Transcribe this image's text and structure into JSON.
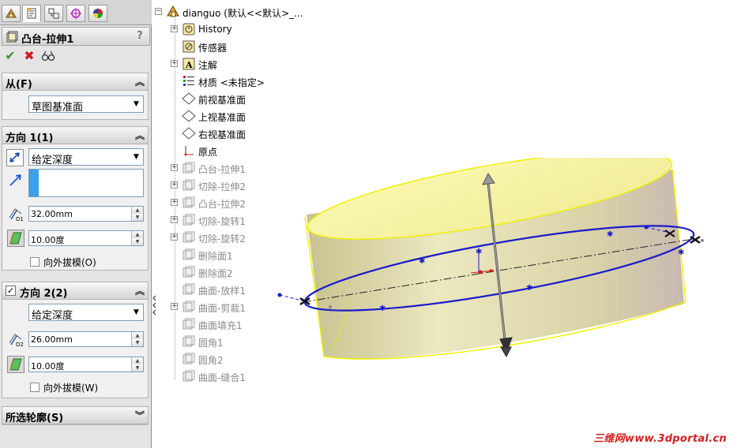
{
  "property_manager": {
    "tabs": [
      "feature-manager-icon",
      "property-manager-icon",
      "configuration-manager-icon",
      "dimxpert-icon",
      "display-manager-icon"
    ],
    "title": "凸台-拉伸1",
    "help_label": "?",
    "from": {
      "header": "从(F)",
      "value": "草图基准面"
    },
    "direction1": {
      "header": "方向 1(1)",
      "end_condition": "给定深度",
      "depth": "32.00mm",
      "depth_tag": "D1",
      "draft_angle": "10.00度",
      "draft_outward": "向外拔模(O)"
    },
    "direction2": {
      "header": "方向 2(2)",
      "enabled_mark": "✓",
      "end_condition": "给定深度",
      "depth": "26.00mm",
      "depth_tag": "D2",
      "draft_angle": "10.00度",
      "draft_outward": "向外拔模(W)"
    },
    "selected_contours": {
      "header": "所选轮廓(S)"
    }
  },
  "tree": {
    "root": "dianguo  (默认<<默认>_...",
    "items": [
      {
        "label": "History",
        "expand": "+",
        "dim": false
      },
      {
        "label": "传感器",
        "expand": "",
        "dim": false
      },
      {
        "label": "注解",
        "expand": "+",
        "dim": false
      },
      {
        "label": "材质 <未指定>",
        "expand": "",
        "dim": false
      },
      {
        "label": "前视基准面",
        "expand": "",
        "dim": false
      },
      {
        "label": "上视基准面",
        "expand": "",
        "dim": false
      },
      {
        "label": "右视基准面",
        "expand": "",
        "dim": false
      },
      {
        "label": "原点",
        "expand": "",
        "dim": false
      },
      {
        "label": "凸台-拉伸1",
        "expand": "+",
        "dim": true
      },
      {
        "label": "切除-拉伸2",
        "expand": "+",
        "dim": true
      },
      {
        "label": "凸台-拉伸2",
        "expand": "+",
        "dim": true
      },
      {
        "label": "切除-旋转1",
        "expand": "+",
        "dim": true
      },
      {
        "label": "切除-旋转2",
        "expand": "+",
        "dim": true
      },
      {
        "label": "删除面1",
        "expand": "",
        "dim": true
      },
      {
        "label": "删除面2",
        "expand": "",
        "dim": true
      },
      {
        "label": "曲面-放样1",
        "expand": "",
        "dim": true
      },
      {
        "label": "曲面-剪裁1",
        "expand": "+",
        "dim": true
      },
      {
        "label": "曲面填充1",
        "expand": "",
        "dim": true
      },
      {
        "label": "圆角1",
        "expand": "",
        "dim": true
      },
      {
        "label": "圆角2",
        "expand": "",
        "dim": true
      },
      {
        "label": "曲面-缝合1",
        "expand": "",
        "dim": true
      }
    ]
  },
  "watermark": "三维网www.3dportal.cn",
  "colors": {
    "accept": "#2f9a2f",
    "cancel": "#d01818",
    "sketch_blue": "#1a1acc",
    "body_fill": "#e6e2b0",
    "body_edge": "#f2f200"
  }
}
